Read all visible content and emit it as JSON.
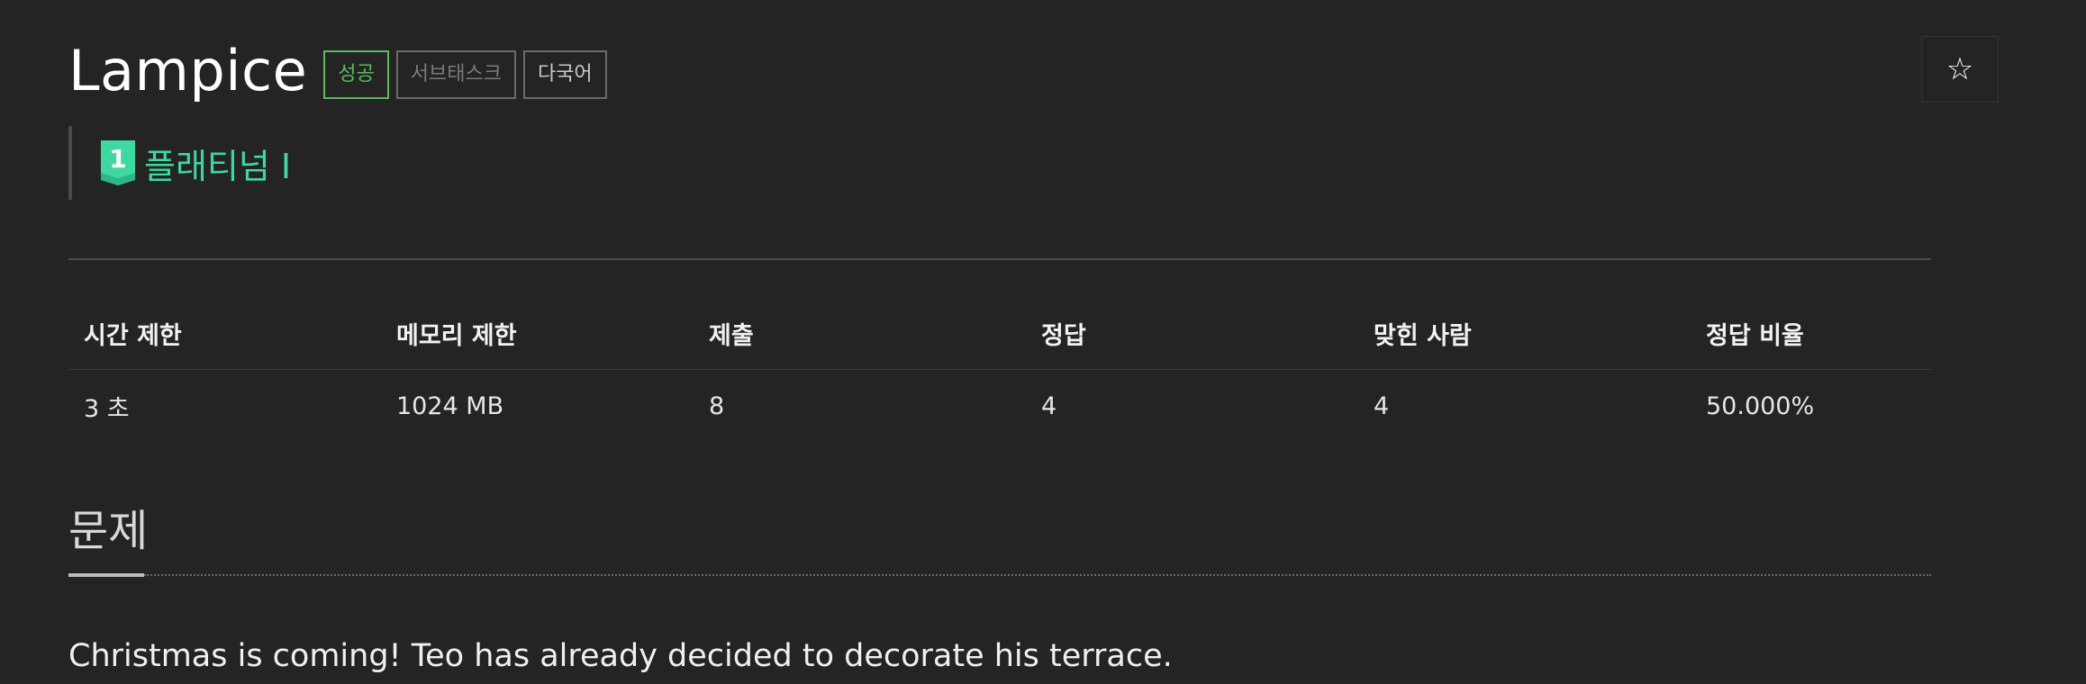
{
  "problem": {
    "title": "Lampice",
    "labels": {
      "success": "성공",
      "subtask": "서브태스크",
      "multilang": "다국어"
    },
    "tier": {
      "number": "1",
      "name": "플래티넘 I",
      "color": "#3fd8a0"
    },
    "star_icon": "star-outline-icon"
  },
  "info": {
    "headers": [
      "시간 제한",
      "메모리 제한",
      "제출",
      "정답",
      "맞힌 사람",
      "정답 비율"
    ],
    "values": [
      "3 초",
      "1024 MB",
      "8",
      "4",
      "4",
      "50.000%"
    ]
  },
  "section": {
    "title": "문제",
    "text": "Christmas is coming! Teo has already decided to decorate his terrace."
  },
  "colors": {
    "background": "#242424",
    "success": "#5cb85c",
    "tier": "#3fd8a0"
  }
}
